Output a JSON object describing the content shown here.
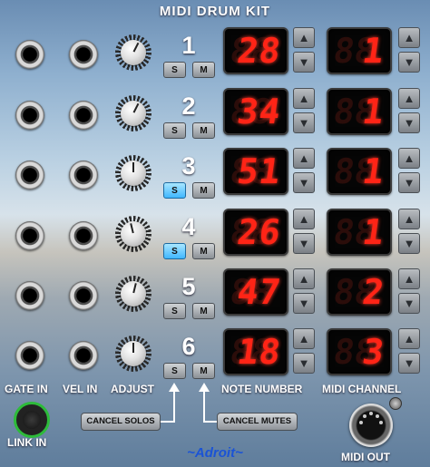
{
  "title": "MIDI DRUM KIT",
  "rows": [
    {
      "num": "1",
      "solo_label": "S",
      "mute_label": "M",
      "solo_on": false,
      "note": "28",
      "channel": "1",
      "knob_level": 0.6
    },
    {
      "num": "2",
      "solo_label": "S",
      "mute_label": "M",
      "solo_on": false,
      "note": "34",
      "channel": "1",
      "knob_level": 0.6
    },
    {
      "num": "3",
      "solo_label": "S",
      "mute_label": "M",
      "solo_on": true,
      "note": "51",
      "channel": "1",
      "knob_level": 0.5
    },
    {
      "num": "4",
      "solo_label": "S",
      "mute_label": "M",
      "solo_on": true,
      "note": "26",
      "channel": "1",
      "knob_level": 0.45
    },
    {
      "num": "5",
      "solo_label": "S",
      "mute_label": "M",
      "solo_on": false,
      "note": "47",
      "channel": "2",
      "knob_level": 0.55
    },
    {
      "num": "6",
      "solo_label": "S",
      "mute_label": "M",
      "solo_on": false,
      "note": "18",
      "channel": "3",
      "knob_level": 0.5
    }
  ],
  "labels": {
    "gate_in": "GATE IN",
    "vel_in": "VEL IN",
    "adjust": "ADJUST",
    "note_number": "NOTE NUMBER",
    "midi_channel": "MIDI CHANNEL",
    "link_in": "LINK IN",
    "midi_out": "MIDI OUT"
  },
  "buttons": {
    "cancel_solos": "CANCEL SOLOS",
    "cancel_mutes": "CANCEL MUTES"
  },
  "brand": "~Adroit~",
  "icons": {
    "up": "up-arrow-icon",
    "down": "down-arrow-icon"
  },
  "colors": {
    "display_digit": "#ff2416",
    "solo_active": "#3fb6ff",
    "link_ring": "#2dbb3a",
    "brand": "#1a53d6"
  }
}
